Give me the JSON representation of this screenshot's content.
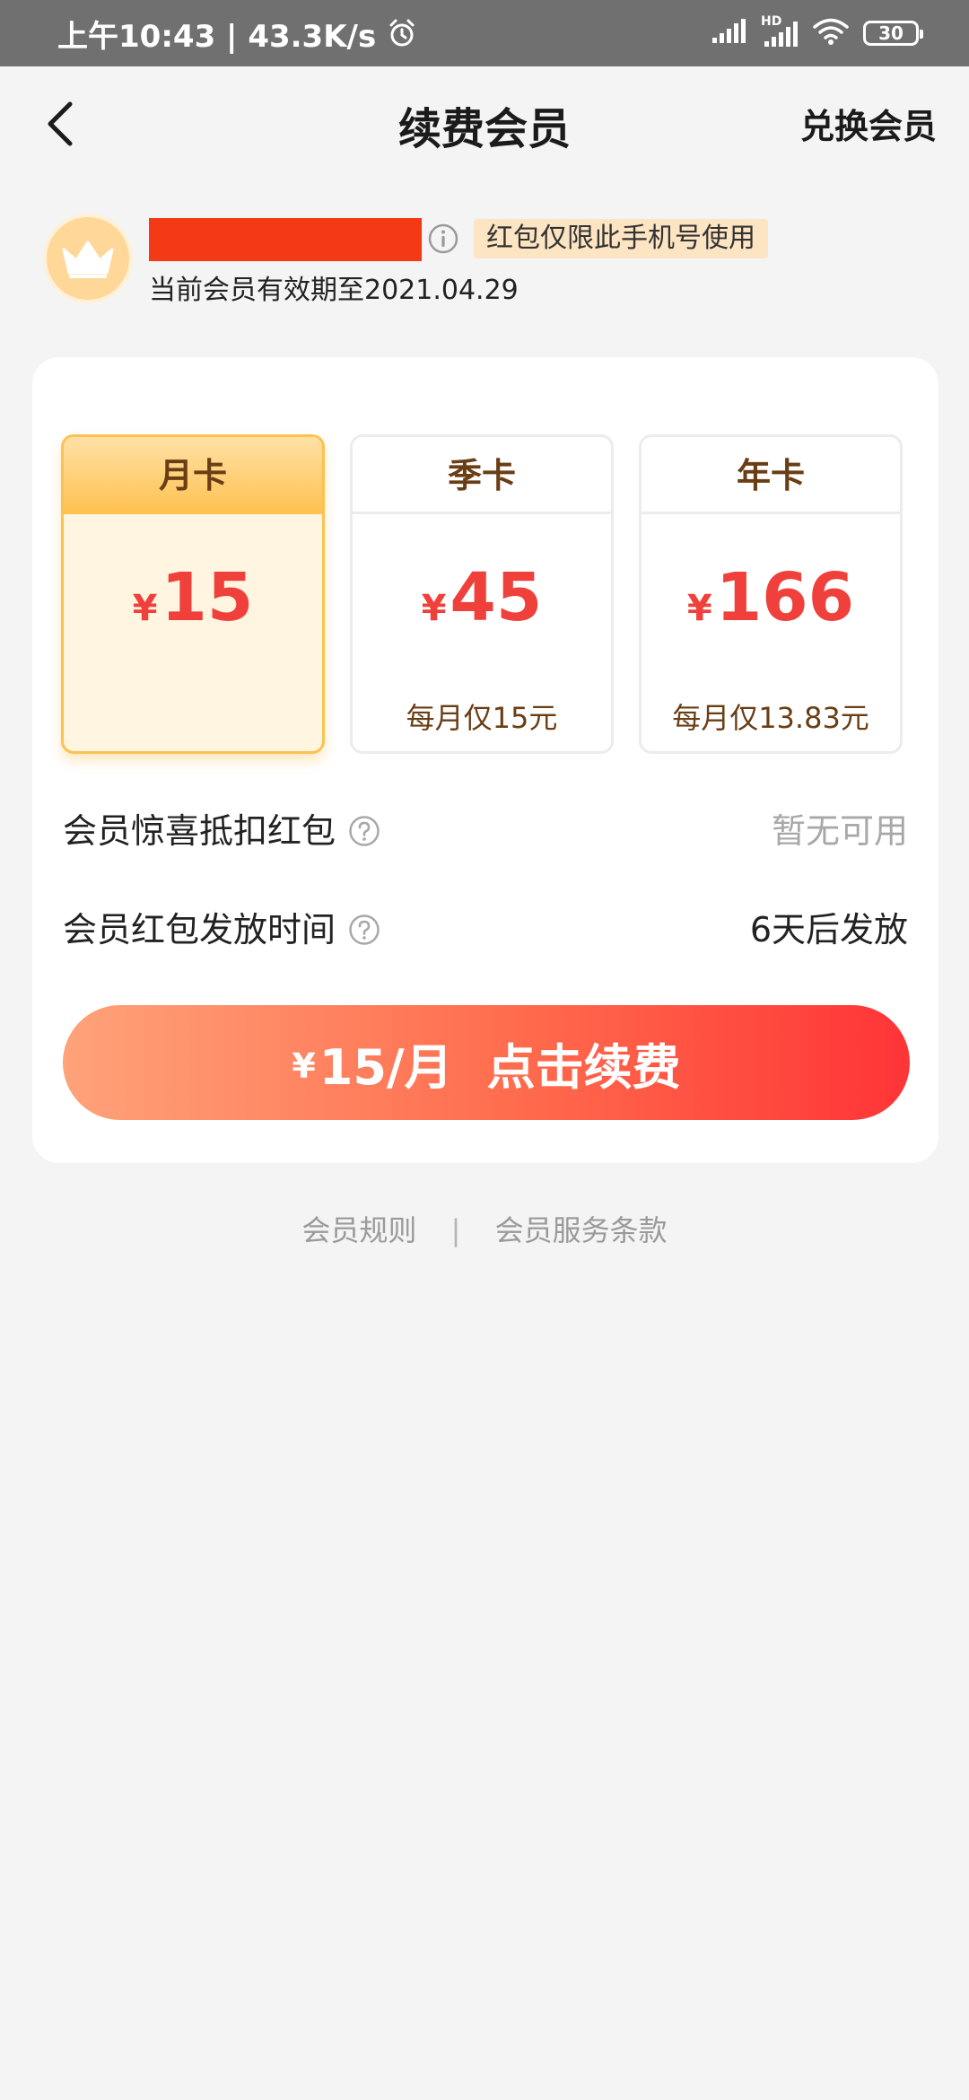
{
  "status_bar": {
    "time_and_speed": "上午10:43 | 43.3K/s",
    "network_hd_label": "HD",
    "battery_level": "30"
  },
  "header": {
    "title": "续费会员",
    "redeem_label": "兑换会员"
  },
  "user": {
    "phone_badge": "红包仅限此手机号使用",
    "expiry_text": "当前会员有效期至2021.04.29"
  },
  "plans": [
    {
      "name": "月卡",
      "currency": "¥",
      "price": "15",
      "note": "",
      "selected": true
    },
    {
      "name": "季卡",
      "currency": "¥",
      "price": "45",
      "note": "每月仅15元",
      "selected": false
    },
    {
      "name": "年卡",
      "currency": "¥",
      "price": "166",
      "note": "每月仅13.83元",
      "selected": false
    }
  ],
  "options": {
    "coupon_label": "会员惊喜抵扣红包",
    "coupon_value": "暂无可用",
    "redpacket_time_label": "会员红包发放时间",
    "redpacket_time_value": "6天后发放"
  },
  "renew_button": {
    "currency": "¥",
    "price_label": "15/月",
    "action_label": "点击续费"
  },
  "footer": {
    "rules_label": "会员规则",
    "separator": "|",
    "terms_label": "会员服务条款"
  },
  "colors": {
    "accent_red": "#f0403b",
    "gold": "#fdc151",
    "badge_bg": "#fde4c2",
    "redacted": "#f33a14"
  },
  "icons": [
    "back-arrow-icon",
    "alarm-clock-icon",
    "signal-icon",
    "wifi-icon",
    "battery-icon",
    "crown-icon",
    "info-icon",
    "help-icon"
  ]
}
